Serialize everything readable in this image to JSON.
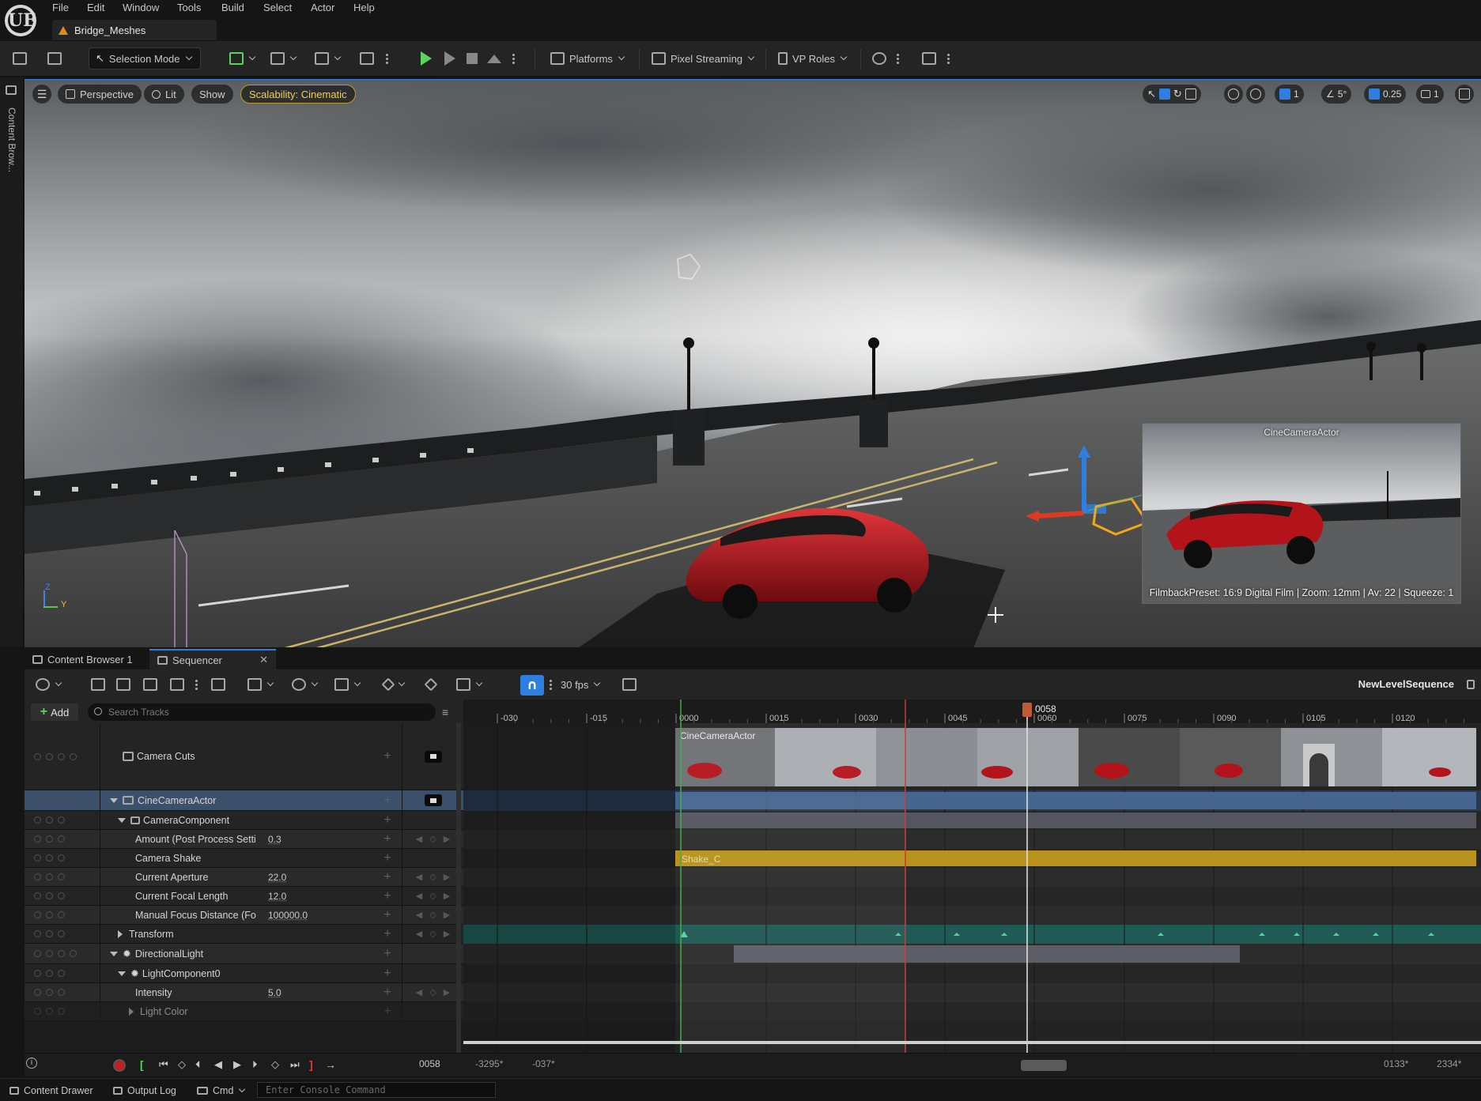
{
  "app": {
    "logo": "UE",
    "document_tab": "Bridge_Meshes"
  },
  "menu": [
    "File",
    "Edit",
    "Window",
    "Tools",
    "Build",
    "Select",
    "Actor",
    "Help"
  ],
  "toolbar": {
    "selection_mode": "Selection Mode",
    "platforms": "Platforms",
    "pixel_streaming": "Pixel Streaming",
    "vp_roles": "VP Roles"
  },
  "left_strip": {
    "label": "Content Brow..."
  },
  "viewport": {
    "perspective": "Perspective",
    "lit": "Lit",
    "show": "Show",
    "scalability": "Scalability: Cinematic",
    "grid_snap": "1",
    "rotation_snap": "5°",
    "scale_snap": "0.25",
    "camera_speed": "1",
    "axis_z": "Z",
    "axis_y": "Y",
    "pip": {
      "title": "CineCameraActor",
      "info": "FilmbackPreset: 16:9 Digital Film | Zoom: 12mm | Av: 22 | Squeeze: 1"
    },
    "colors": {
      "accent_blue": "#2f7fe0",
      "car_red": "#b3141c",
      "gizmo_yellow": "#f2a71b"
    }
  },
  "panel_tabs": {
    "content_browser": "Content Browser 1",
    "sequencer": "Sequencer"
  },
  "sequencer": {
    "fps": "30 fps",
    "sequence_name": "NewLevelSequence",
    "add_label": "Add",
    "search_placeholder": "Search Tracks",
    "tracks": [
      {
        "label": "Camera Cuts",
        "value": ""
      },
      {
        "label": "CineCameraActor",
        "value": ""
      },
      {
        "label": "CameraComponent",
        "value": ""
      },
      {
        "label": "Amount (Post Process Setti",
        "value": "0.3"
      },
      {
        "label": "Camera Shake",
        "value": ""
      },
      {
        "label": "Current Aperture",
        "value": "22.0"
      },
      {
        "label": "Current Focal Length",
        "value": "12.0"
      },
      {
        "label": "Manual Focus Distance (Fo",
        "value": "100000.0"
      },
      {
        "label": "Transform",
        "value": ""
      },
      {
        "label": "DirectionalLight",
        "value": ""
      },
      {
        "label": "LightComponent0",
        "value": ""
      },
      {
        "label": "Intensity",
        "value": "5.0"
      },
      {
        "label": "Light Color",
        "value": ""
      }
    ],
    "ruler": {
      "playhead_label": "0058",
      "ticks": [
        "-030",
        "-015",
        "0000",
        "0015",
        "0030",
        "0045",
        "0060",
        "0075",
        "0090",
        "0105",
        "0120"
      ]
    },
    "clips": {
      "camera_cut": "CineCameraActor",
      "shake": "Shake_C"
    },
    "playback": {
      "current_frame": "0058",
      "view_start": "-3295*",
      "work_start": "-037*",
      "work_end": "0133*",
      "view_end": "2334*"
    }
  },
  "statusbar": {
    "content_drawer": "Content Drawer",
    "output_log": "Output Log",
    "cmd": "Cmd",
    "console_placeholder": "Enter Console Command"
  }
}
